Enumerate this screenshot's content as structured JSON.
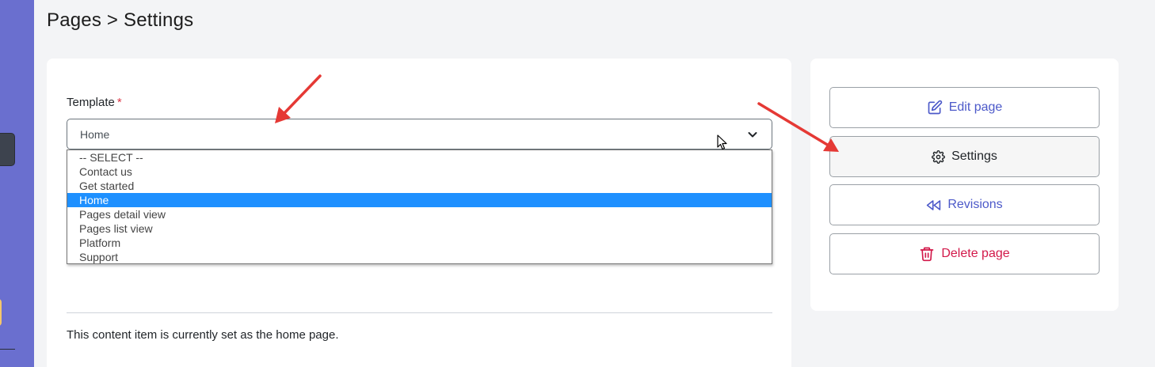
{
  "breadcrumb": "Pages > Settings",
  "form": {
    "template_label": "Template",
    "required_mark": "*",
    "selected_value": "Home",
    "options": [
      "-- SELECT --",
      "Contact us",
      "Get started",
      "Home",
      "Pages detail view",
      "Pages list view",
      "Platform",
      "Support"
    ],
    "note": "This content item is currently set as the home page."
  },
  "actions": {
    "edit": "Edit page",
    "settings": "Settings",
    "revisions": "Revisions",
    "delete": "Delete page"
  },
  "icons": [
    "chevron-down-icon",
    "cursor-icon",
    "edit-icon",
    "gear-icon",
    "rewind-icon",
    "trash-icon",
    "annotation-arrow"
  ],
  "colors": {
    "sidebar": "#6a6fcf",
    "primary": "#4c59c9",
    "danger": "#d2194a",
    "highlight": "#1e90ff",
    "annotation": "#e53935"
  }
}
